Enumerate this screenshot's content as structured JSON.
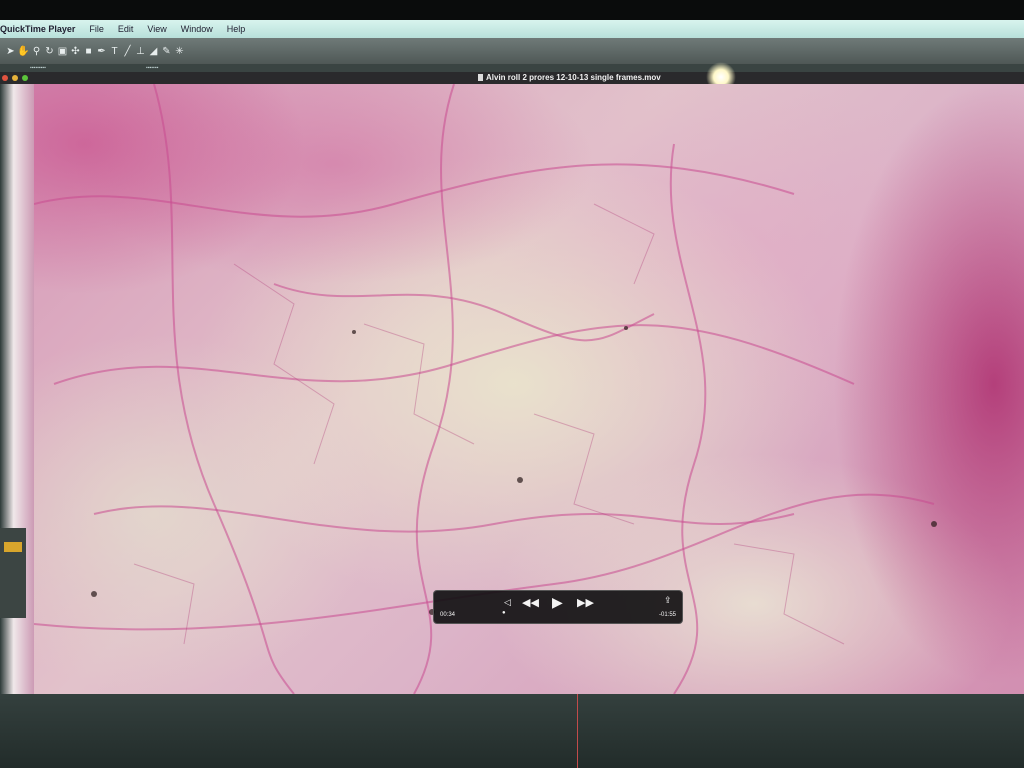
{
  "menubar": {
    "app_name": "QuickTime Player",
    "items": [
      "File",
      "Edit",
      "View",
      "Window",
      "Help"
    ]
  },
  "toolbar": {
    "tools": [
      "selection-tool-icon",
      "hand-tool-icon",
      "zoom-tool-icon",
      "rotate-tool-icon",
      "camera-tool-icon",
      "pan-behind-tool-icon",
      "rectangle-tool-icon",
      "pen-tool-icon",
      "type-tool-icon",
      "brush-tool-icon",
      "clone-stamp-tool-icon",
      "eraser-tool-icon",
      "roto-brush-tool-icon",
      "puppet-tool-icon"
    ]
  },
  "player": {
    "title": "Alvin roll 2 prores 12-10-13 single frames.mov",
    "elapsed_time": "00:34",
    "remaining_time": "-01:55",
    "controls": {
      "rewind_icon": "rewind-icon",
      "play_icon": "play-icon",
      "fast_forward_icon": "fast-forward-icon",
      "share_icon": "share-icon"
    }
  },
  "colors": {
    "menubar": "#c8ece6",
    "hud_background": "#0e0e10",
    "close": "#e2533f",
    "minimize": "#e6b23a",
    "zoom": "#5cc53b"
  }
}
